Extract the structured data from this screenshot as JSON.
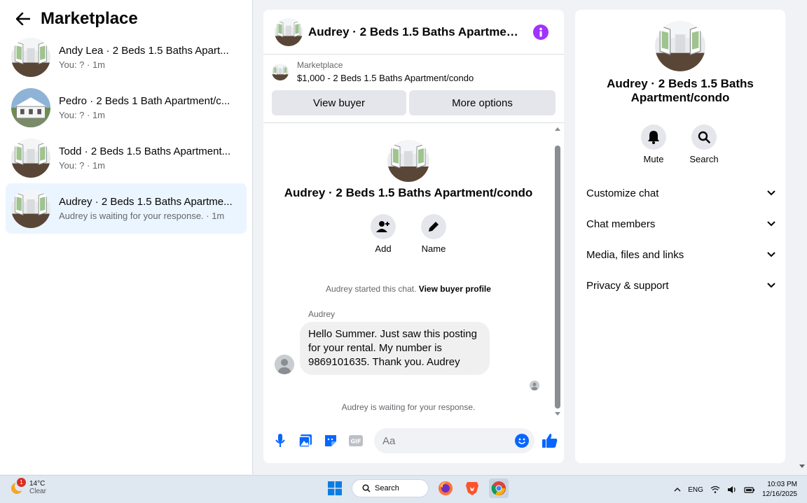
{
  "left": {
    "title": "Marketplace",
    "conversations": [
      {
        "title": "Andy Lea · 2 Beds 1.5 Baths Apart...",
        "subtitle": "You: ? · 1m",
        "active": false
      },
      {
        "title": "Pedro · 2 Beds 1 Bath Apartment/c...",
        "subtitle": "You: ? · 1m",
        "active": false
      },
      {
        "title": "Todd · 2 Beds 1.5 Baths Apartment...",
        "subtitle": "You: ? · 1m",
        "active": false
      },
      {
        "title": "Audrey · 2 Beds 1.5 Baths Apartme...",
        "subtitle": "Audrey is waiting for your response. · 1m",
        "active": true
      }
    ]
  },
  "chat": {
    "header_title": "Audrey · 2 Beds 1.5 Baths Apartment/...",
    "marketplace_label": "Marketplace",
    "listing": "$1,000 - 2 Beds 1.5 Baths Apartment/condo",
    "view_buyer_label": "View buyer",
    "more_options_label": "More options",
    "profile_name": "Audrey · 2 Beds 1.5 Baths Apartment/condo",
    "add_label": "Add",
    "name_label": "Name",
    "started_text": "Audrey started this chat.",
    "view_profile_link": "View buyer profile",
    "sender": "Audrey",
    "message": "Hello Summer. Just saw this posting for your rental. My number is 9869101635. Thank you. Audrey",
    "waiting_text": "Audrey is waiting for your response.",
    "input_placeholder": "Aa"
  },
  "right": {
    "title": "Audrey · 2 Beds 1.5 Baths Apartment/condo",
    "mute_label": "Mute",
    "search_label": "Search",
    "sections": [
      "Customize chat",
      "Chat members",
      "Media, files and links",
      "Privacy & support"
    ]
  },
  "taskbar": {
    "temperature": "14°C",
    "weather": "Clear",
    "weather_badge": "1",
    "search_label": "Search",
    "language": "ENG",
    "time": "10:03 PM",
    "date": "12/16/2025"
  },
  "colors": {
    "accent": "#0866ff",
    "info": "#a033ff",
    "active_bg": "#ebf5ff"
  }
}
